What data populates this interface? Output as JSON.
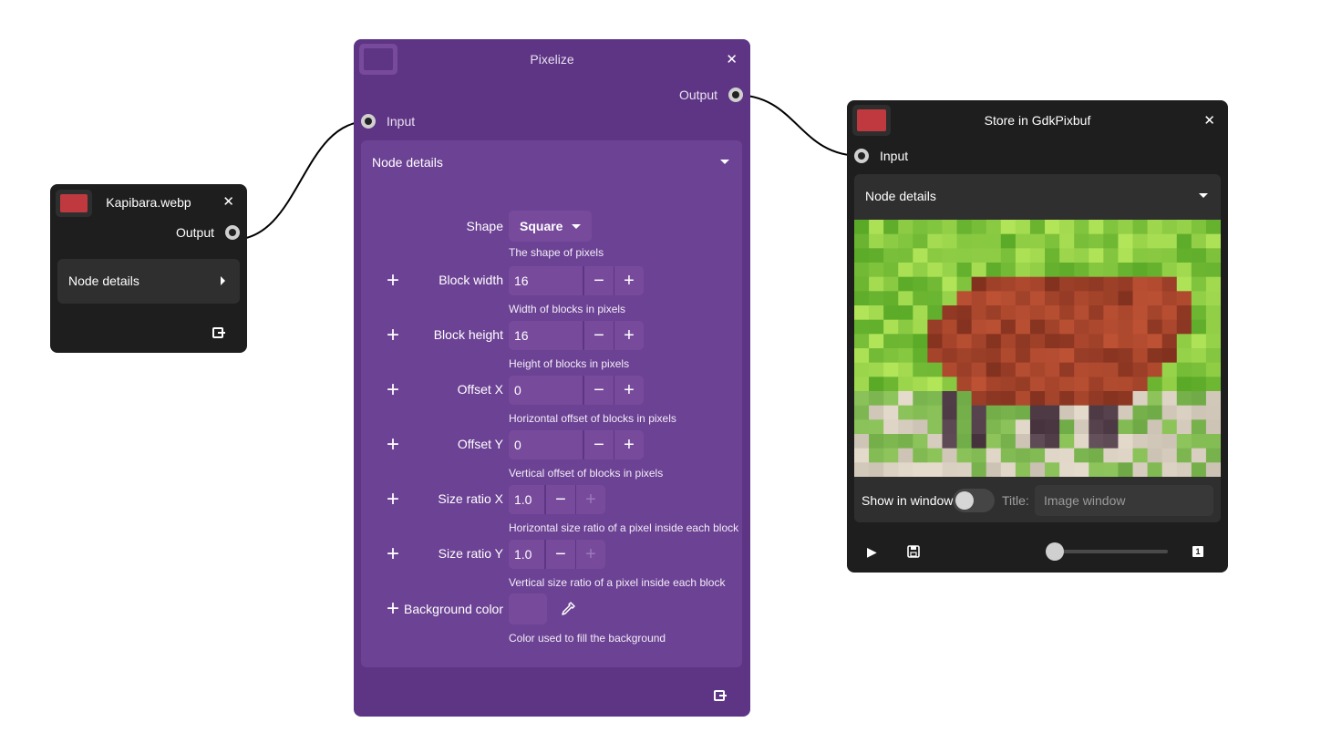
{
  "nodes": {
    "kapibara": {
      "title": "Kapibara.webp",
      "color": "#c0393e",
      "output_label": "Output",
      "details_label": "Node details"
    },
    "pixelize": {
      "title": "Pixelize",
      "input_label": "Input",
      "output_label": "Output",
      "details_label": "Node details",
      "properties": {
        "shape": {
          "label": "Shape",
          "value": "Square",
          "hint": "The shape of pixels"
        },
        "block_width": {
          "label": "Block width",
          "value": "16",
          "hint": "Width of blocks in pixels"
        },
        "block_height": {
          "label": "Block height",
          "value": "16",
          "hint": "Height of blocks in pixels"
        },
        "offset_x": {
          "label": "Offset X",
          "value": "0",
          "hint": "Horizontal offset of blocks in pixels"
        },
        "offset_y": {
          "label": "Offset Y",
          "value": "0",
          "hint": "Vertical offset of blocks in pixels"
        },
        "size_ratio_x": {
          "label": "Size ratio X",
          "value": "1.0",
          "hint": "Horizontal size ratio of a pixel inside each block"
        },
        "size_ratio_y": {
          "label": "Size ratio Y",
          "value": "1.0",
          "hint": "Vertical size ratio of a pixel inside each block"
        },
        "background_color": {
          "label": "Background color",
          "hint": "Color used to fill the background"
        }
      }
    },
    "gdkpixbuf": {
      "title": "Store in GdkPixbuf",
      "color": "#c0393e",
      "input_label": "Input",
      "details_label": "Node details",
      "show_in_window_label": "Show in window",
      "show_in_window": false,
      "title_label": "Title:",
      "title_placeholder": "Image window",
      "frame_badge": "1",
      "slider_fraction": 0.0
    }
  },
  "icons": {
    "close": "✕",
    "plus": "+",
    "minus": "−",
    "play": "▶"
  }
}
